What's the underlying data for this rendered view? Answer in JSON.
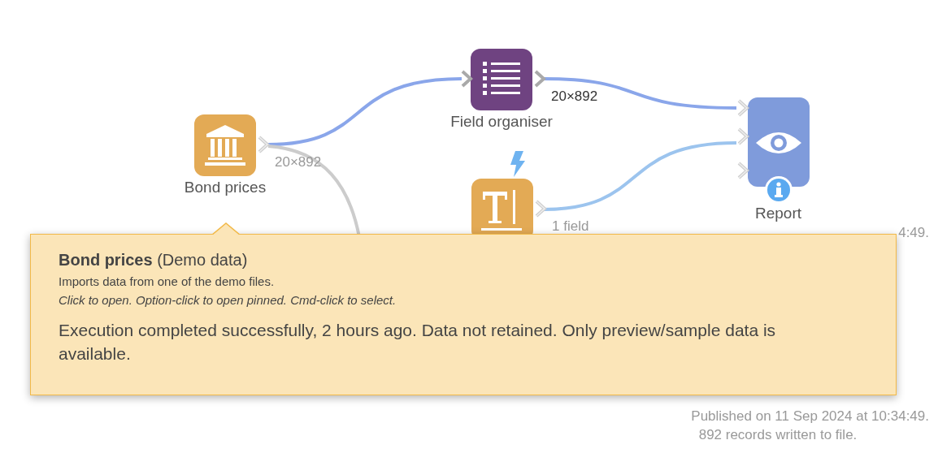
{
  "nodes": [
    {
      "kind": "source",
      "label": "Bond prices",
      "output": "20×892"
    },
    {
      "kind": "organiser",
      "label": "Field organiser",
      "output": "20×892"
    },
    {
      "kind": "text",
      "output": "1 field",
      "triggered": true
    },
    {
      "kind": "report",
      "label": "Report",
      "status": "4:49.",
      "published": "Published on 11 Sep 2024 at 10:34:49.",
      "records": "892 records written to file."
    }
  ],
  "tooltip": {
    "title": "Bond prices",
    "subtitle": "(Demo data)",
    "description": "Imports data from one of the demo files.",
    "hint": "Click to open. Option-click to open pinned. Cmd-click to select.",
    "status": "Execution completed successfully, 2 hours ago. Data not retained. Only preview/sample data is available."
  }
}
